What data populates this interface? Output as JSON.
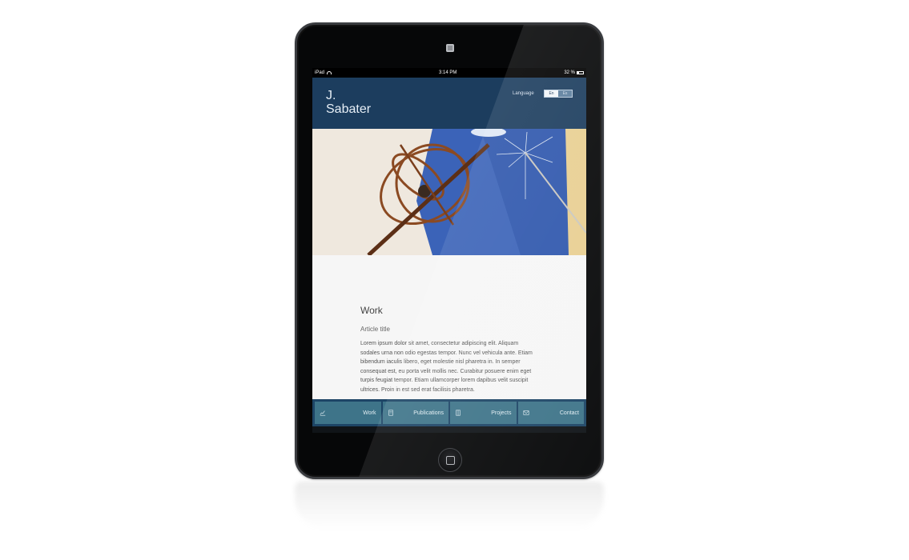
{
  "status_bar": {
    "carrier": "iPad",
    "time": "3:14 PM",
    "battery": "32 %"
  },
  "header": {
    "logo_line1": "J.",
    "logo_line2": "Sabater",
    "language_label": "Language",
    "languages": [
      "En",
      "Es"
    ],
    "selected_language": "En"
  },
  "hero": {
    "icon": "armillary-sphere-photo"
  },
  "main": {
    "section_title": "Work",
    "article_title": "Article title",
    "article_body": "Lorem ipsum dolor sit amet, consectetur adipiscing elit. Aliquam sodales urna non odio egestas tempor. Nunc vel vehicula ante. Etiam bibendum iaculis libero, eget molestie nisl pharetra in. In semper consequat est, eu porta velit mollis nec. Curabitur posuere enim eget turpis feugiat tempor. Etiam ullamcorper lorem dapibus velit suscipit ultrices. Proin in est sed erat facilisis pharetra."
  },
  "tabs": [
    {
      "label": "Work",
      "icon": "chart-icon"
    },
    {
      "label": "Publications",
      "icon": "document-icon"
    },
    {
      "label": "Projects",
      "icon": "film-icon"
    },
    {
      "label": "Contact",
      "icon": "envelope-icon"
    }
  ],
  "colors": {
    "header_bg": "#1c3d5e",
    "tab_bg": "#3e7489",
    "tabbar_bg": "#1d4566"
  }
}
